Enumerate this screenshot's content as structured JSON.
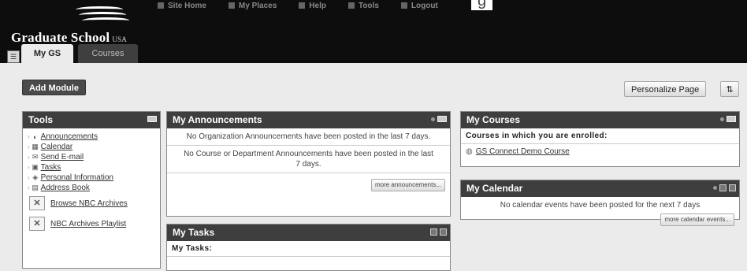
{
  "header": {
    "logo_text": "Graduate School",
    "logo_suffix": "USA",
    "top_links": [
      "Site Home",
      "My Places",
      "Help",
      "Tools",
      "Logout"
    ],
    "reg_heading": "g"
  },
  "tabs": [
    {
      "label": "My GS",
      "active": true
    },
    {
      "label": "Courses",
      "active": false
    }
  ],
  "toolbar": {
    "add_module": "Add Module",
    "personalize": "Personalize Page",
    "reorder_icon": "up-down-arrows-icon"
  },
  "tools": {
    "title": "Tools",
    "items": [
      {
        "label": "Announcements",
        "icon": "megaphone-icon"
      },
      {
        "label": "Calendar",
        "icon": "calendar-icon"
      },
      {
        "label": "Send E-mail",
        "icon": "envelope-icon"
      },
      {
        "label": "Tasks",
        "icon": "tasks-icon"
      },
      {
        "label": "Personal Information",
        "icon": "person-icon"
      },
      {
        "label": "Address Book",
        "icon": "address-book-icon"
      }
    ],
    "nbc_items": [
      "Browse NBC Archives",
      "NBC Archives Playlist"
    ]
  },
  "announcements": {
    "title": "My Announcements",
    "org_message": "No Organization Announcements have been posted in the last 7 days.",
    "course_message": "No Course or Department Announcements have been posted in the last 7 days.",
    "more_button": "more announcements..."
  },
  "tasks": {
    "title": "My Tasks",
    "subheading": "My Tasks:"
  },
  "courses": {
    "title": "My Courses",
    "subheading": "Courses in which you are enrolled:",
    "items": [
      "GS Connect Demo Course"
    ]
  },
  "calendar": {
    "title": "My Calendar",
    "message": "No calendar events have been posted for the next 7 days",
    "more_button": "more calendar events..."
  }
}
